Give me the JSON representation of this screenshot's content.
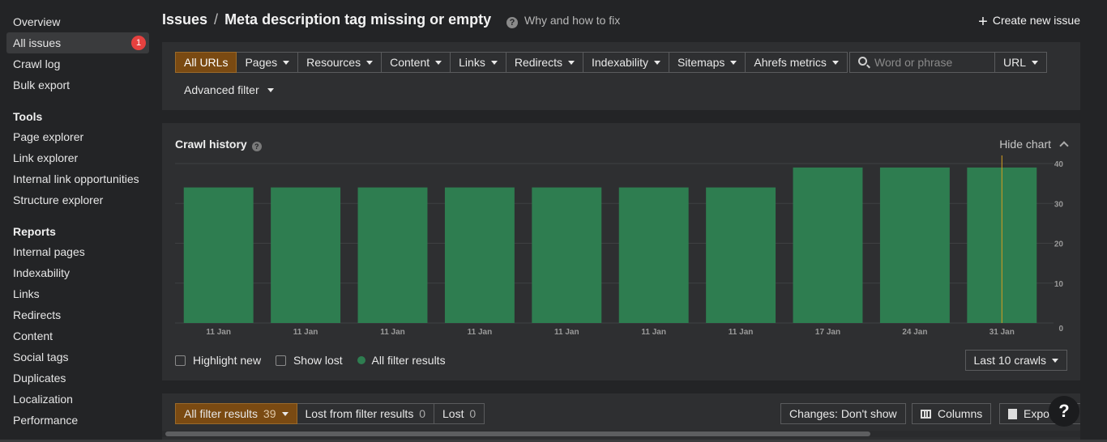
{
  "sidebar": {
    "items_top": [
      {
        "label": "Overview",
        "active": false
      },
      {
        "label": "All issues",
        "active": true,
        "badge": "1"
      },
      {
        "label": "Crawl log",
        "active": false
      },
      {
        "label": "Bulk export",
        "active": false
      }
    ],
    "tools_heading": "Tools",
    "tools": [
      "Page explorer",
      "Link explorer",
      "Internal link opportunities",
      "Structure explorer"
    ],
    "reports_heading": "Reports",
    "reports": [
      "Internal pages",
      "Indexability",
      "Links",
      "Redirects",
      "Content",
      "Social tags",
      "Duplicates",
      "Localization",
      "Performance"
    ]
  },
  "header": {
    "crumb_root": "Issues",
    "separator": "/",
    "title": "Meta description tag missing or empty",
    "why_link": "Why and how to fix",
    "create_button": "Create new issue"
  },
  "filters": {
    "tabs": [
      {
        "label": "All URLs",
        "selected": true,
        "dropdown": false
      },
      {
        "label": "Pages",
        "dropdown": true
      },
      {
        "label": "Resources",
        "dropdown": true
      },
      {
        "label": "Content",
        "dropdown": true
      },
      {
        "label": "Links",
        "dropdown": true
      },
      {
        "label": "Redirects",
        "dropdown": true
      },
      {
        "label": "Indexability",
        "dropdown": true
      },
      {
        "label": "Sitemaps",
        "dropdown": true
      },
      {
        "label": "Ahrefs metrics",
        "dropdown": true
      }
    ],
    "search_placeholder": "Word or phrase",
    "search_value": "",
    "search_scope": "URL",
    "advanced_filter": "Advanced filter"
  },
  "crawl_history": {
    "title": "Crawl history",
    "hide_chart": "Hide chart",
    "highlight_new": "Highlight new",
    "show_lost": "Show lost",
    "legend_all": "All filter results",
    "range_select": "Last 10 crawls"
  },
  "chart_data": {
    "type": "bar",
    "categories": [
      "11 Jan",
      "11 Jan",
      "11 Jan",
      "11 Jan",
      "11 Jan",
      "11 Jan",
      "11 Jan",
      "17 Jan",
      "24 Jan",
      "31 Jan"
    ],
    "series": [
      {
        "name": "All filter results",
        "values": [
          34,
          34,
          34,
          34,
          34,
          34,
          34,
          39,
          39,
          39
        ],
        "color": "#2e7d50"
      }
    ],
    "y_ticks": [
      0,
      10,
      20,
      30,
      40
    ],
    "ylim": [
      0,
      40
    ],
    "grid": true,
    "marker_category_index": 9,
    "marker_color": "#d8a020"
  },
  "results": {
    "tabs": [
      {
        "label": "All filter results",
        "count": "39",
        "selected": true
      },
      {
        "label": "Lost from filter results",
        "count": "0",
        "selected": false
      },
      {
        "label": "Lost",
        "count": "0",
        "selected": false
      }
    ],
    "changes_button": "Changes: Don't show",
    "columns_button": "Columns",
    "export_button": "Export",
    "help_button": "?"
  },
  "colors": {
    "background": "#232426",
    "panel": "#2e2f31",
    "accent_selected": "#7a4a12",
    "bar": "#2e7d50",
    "badge": "#e5413f"
  }
}
